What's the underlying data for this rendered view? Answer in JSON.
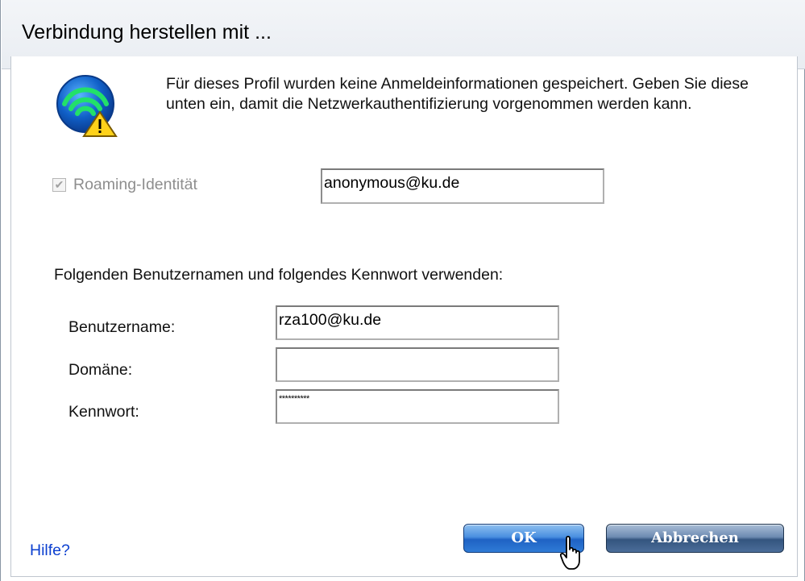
{
  "window": {
    "title": "Verbindung herstellen mit ..."
  },
  "intro_text": "Für dieses Profil wurden keine Anmeldeinformationen gespeichert. Geben Sie diese unten ein, damit die Netzwerkauthentifizierung vorgenommen werden kann.",
  "roaming": {
    "label": "Roaming-Identität",
    "checked": true,
    "enabled": false,
    "value": "anonymous@ku.de"
  },
  "credentials": {
    "section_label": "Folgenden Benutzernamen und folgendes Kennwort verwenden:",
    "username_label": "Benutzername:",
    "username_value": "rza100@ku.de",
    "domain_label": "Domäne:",
    "domain_value": "",
    "password_label": "Kennwort:",
    "password_value": "**********"
  },
  "help_link": "Hilfe?",
  "buttons": {
    "ok": "OK",
    "cancel": "Abbrechen"
  },
  "icons": {
    "network": "wireless-network-warning-icon",
    "pointer": "mouse-pointer-icon"
  }
}
